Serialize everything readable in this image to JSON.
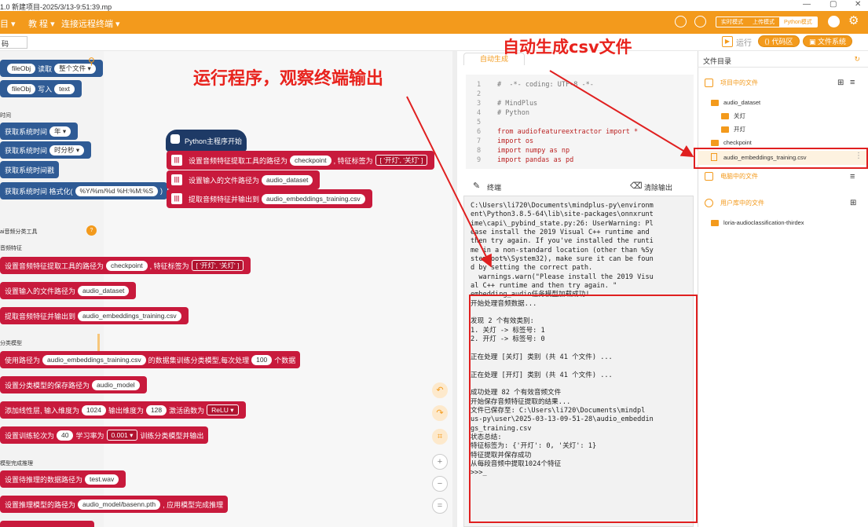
{
  "window": {
    "title": "1.0   新建项目-2025/3/13-9:51:39.mp",
    "controls": [
      "—",
      "▢",
      "✕"
    ]
  },
  "menu": {
    "items": [
      "目 ▾",
      "教 程 ▾",
      "连接远程终端 ▾"
    ],
    "modes": [
      "实时模式",
      "上传模式",
      "Python模式"
    ]
  },
  "toolbar": {
    "left_tab": "码",
    "run": "运行",
    "code_area": "代码区",
    "file_system": "文件系统"
  },
  "blocks": {
    "read": {
      "a": "fileObj",
      "b": "读取",
      "c": "整个文件 ▾"
    },
    "write": {
      "a": "fileObj",
      "b": "写入",
      "c": "text"
    },
    "cat_time": "时间",
    "time1": {
      "a": "获取系统时间",
      "b": "年 ▾"
    },
    "time2": {
      "a": "获取系统时间",
      "b": "时分秒 ▾"
    },
    "time3": "获取系统时间戳",
    "time4": {
      "a": "获取系统时间 格式化(",
      "b": "%Y/%m/%d %H:%M:%S",
      "c": ")"
    },
    "cat_audio": "ai音频分类工具",
    "cat_feat": "音频特征",
    "p1": {
      "a": "设置音频特征提取工具的路径为",
      "b": "checkpoint",
      "c": ", 特征标签为",
      "d": "[ '开灯', '关灯' ]"
    },
    "p2": {
      "a": "设置输入的文件路径为",
      "b": "audio_dataset"
    },
    "p3": {
      "a": "提取音频特征并输出到",
      "b": "audio_embeddings_training.csv"
    },
    "cat_model": "分类模型",
    "p4": {
      "a": "使用路径为",
      "b": "audio_embeddings_training.csv",
      "c": "的数据集训练分类模型,每次处理",
      "d": "100",
      "e": "个数据"
    },
    "p5": {
      "a": "设置分类模型的保存路径为",
      "b": "audio_model"
    },
    "p6": {
      "a": "添加线性层, 输入维度为",
      "b": "1024",
      "c": "输出维度为",
      "d": "128",
      "e": "激活函数为",
      "f": "ReLU ▾"
    },
    "p7": {
      "a": "设置训练轮次为",
      "b": "40",
      "c": "学习率为",
      "d": "0.001 ▾",
      "e": "训练分类模型并输出"
    },
    "cat_infer": "模型完成推理",
    "p8": {
      "a": "设置待推理的数据路径为",
      "b": "test.wav"
    },
    "p9": {
      "a": "设置推理模型的路径为",
      "b": "audio_model/basenn.pth",
      "c": ", 应用模型完成推理"
    },
    "main": "Python主程序开始",
    "m1": {
      "a": "设置音频特征提取工具的路径为",
      "b": "checkpoint",
      "c": ", 特征标签为",
      "d": "[ '开灯', '关灯' ]"
    },
    "m2": {
      "a": "设置输入的文件路径为",
      "b": "audio_dataset"
    },
    "m3": {
      "a": "提取音频特征并输出到",
      "b": "audio_embeddings_training.csv"
    }
  },
  "code": {
    "tab": "自动生成",
    "lines": [
      {
        "n": "1",
        "t": "#  -*- coding: UTF-8 -*-"
      },
      {
        "n": "2",
        "t": ""
      },
      {
        "n": "3",
        "t": "# MindPlus"
      },
      {
        "n": "4",
        "t": "# Python"
      },
      {
        "n": "5",
        "t": ""
      },
      {
        "n": "6",
        "t": "from audiofeatureextractor import *"
      },
      {
        "n": "7",
        "t": "import os"
      },
      {
        "n": "8",
        "t": "import numpy as np"
      },
      {
        "n": "9",
        "t": "import pandas as pd"
      }
    ]
  },
  "terminal": {
    "title": "终端",
    "clear": "清除输出",
    "text": "C:\\Users\\li720\\Documents\\mindplus-py\\environm\nent\\Python3.8.5-64\\lib\\site-packages\\onnxrunt\nime\\capi\\_pybind_state.py:26: UserWarning: Pl\nease install the 2019 Visual C++ runtime and\nthen try again. If you've installed the runti\nme in a non-standard location (other than %Sy\nstemRoot%\\System32), make sure it can be foun\nd by setting the correct path.\n  warnings.warn(\"Please install the 2019 Visu\nal C++ runtime and then try again. \"\nembedding_audio任务模型加载成功!\n开始处理音频数据...\n\n发现 2 个有效类别:\n1. 关灯 -> 标签号: 1\n2. 开灯 -> 标签号: 0\n\n正在处理 [关灯] 类别 (共 41 个文件) ...\n\n正在处理 [开灯] 类别 (共 41 个文件) ...\n\n成功处理 82 个有效音频文件\n开始保存音频特征提取的结果...\n文件已保存至: C:\\Users\\li720\\Documents\\mindpl\nus-py\\user\\2025-03-13-09-51-28\\audio_embeddin\ngs_training.csv\n状态总结:\n特征标签为: {'开灯': 0, '关灯': 1}\n特征提取并保存成功\n从每段音频中提取1024个特征\n>>>_"
  },
  "files": {
    "header": "文件目录",
    "project": "项目中的文件",
    "items": [
      "audio_dataset",
      "关灯",
      "开灯",
      "checkpoint",
      "audio_embeddings_training.csv"
    ],
    "computer": "电脑中的文件",
    "library": "用户库中的文件",
    "lib_items": [
      "loria-audioclassification-thirdex"
    ]
  },
  "annotations": {
    "run_note": "运行程序，观察终端输出",
    "csv_note": "自动生成csv文件"
  },
  "colors": {
    "accent": "#f39a1c",
    "block_red": "#c81a3c",
    "block_blue": "#2f5b95",
    "annotation": "#e8231d"
  }
}
